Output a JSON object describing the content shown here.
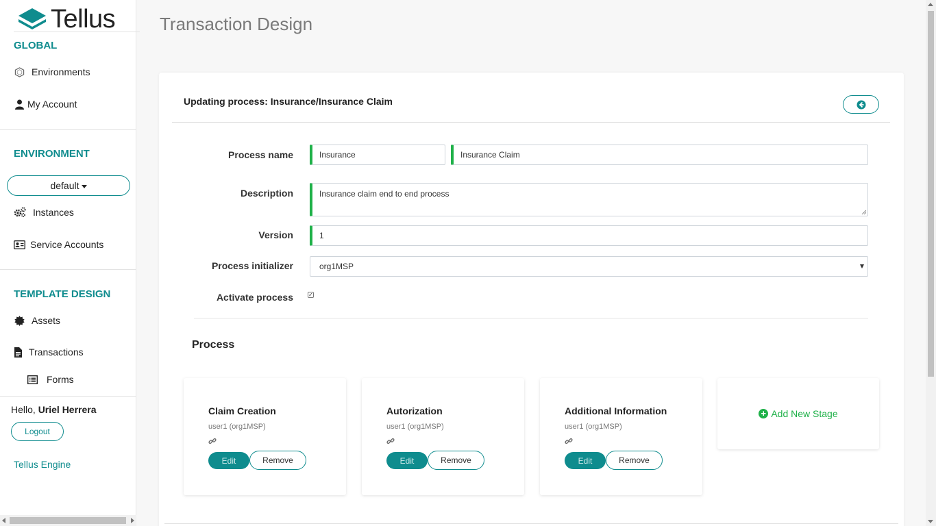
{
  "sidebar": {
    "brand": "Tellus",
    "global_title": "GLOBAL",
    "global_items": [
      {
        "label": "Environments",
        "icon": "hexagon-icon"
      },
      {
        "label": "My Account",
        "icon": "user-icon"
      }
    ],
    "environment_title": "ENVIRONMENT",
    "environment_value": "default",
    "environment_items": [
      {
        "label": "Instances",
        "icon": "gears-icon"
      },
      {
        "label": "Service Accounts",
        "icon": "id-card-icon"
      }
    ],
    "template_title": "TEMPLATE DESIGN",
    "template_items": [
      {
        "label": "Assets",
        "icon": "gear-badge-icon"
      },
      {
        "label": "Transactions",
        "icon": "file-icon"
      },
      {
        "label": "Forms",
        "icon": "list-icon"
      }
    ],
    "hello_prefix": "Hello,",
    "user_name": "Uriel Herrera",
    "logout_label": "Logout",
    "engine_link": "Tellus Engine"
  },
  "main": {
    "page_title": "Transaction Design",
    "card_header": "Updating process: Insurance/Insurance Claim",
    "form": {
      "process_name_label": "Process name",
      "process_name_value1": "Insurance",
      "process_name_value2": "Insurance Claim",
      "description_label": "Description",
      "description_value": "Insurance claim end to end process",
      "version_label": "Version",
      "version_value": "1",
      "initializer_label": "Process initializer",
      "initializer_value": "org1MSP",
      "activate_label": "Activate process",
      "activate_checked": true
    },
    "process_title": "Process",
    "stages": [
      {
        "title": "Claim Creation",
        "user": "user1 (org1MSP)",
        "edit": "Edit",
        "remove": "Remove"
      },
      {
        "title": "Autorization",
        "user": "user1 (org1MSP)",
        "edit": "Edit",
        "remove": "Remove"
      },
      {
        "title": "Additional Information",
        "user": "user1 (org1MSP)",
        "edit": "Edit",
        "remove": "Remove"
      }
    ],
    "add_stage_label": "Add New Stage"
  },
  "colors": {
    "accent": "#0f8c8e",
    "valid": "#1fb149"
  }
}
